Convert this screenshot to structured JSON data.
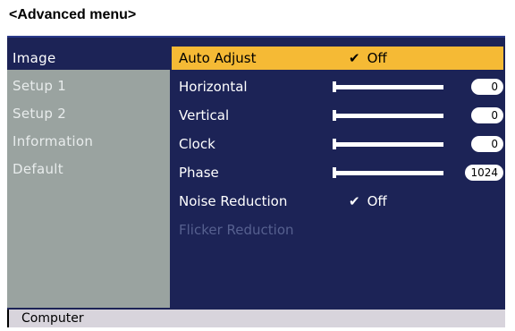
{
  "caption": "<Advanced menu>",
  "sidebar": {
    "items": [
      {
        "label": "Image"
      },
      {
        "label": "Setup 1"
      },
      {
        "label": "Setup 2"
      },
      {
        "label": "Information"
      },
      {
        "label": "Default"
      }
    ]
  },
  "menu": {
    "auto_adjust": {
      "label": "Auto Adjust",
      "mark": "✔",
      "value": "Off"
    },
    "horizontal": {
      "label": "Horizontal",
      "value": "0"
    },
    "vertical": {
      "label": "Vertical",
      "value": "0"
    },
    "clock": {
      "label": "Clock",
      "value": "0"
    },
    "phase": {
      "label": "Phase",
      "value": "1024"
    },
    "noise_reduction": {
      "label": "Noise Reduction",
      "mark": "✔",
      "value": "Off"
    },
    "flicker_reduction": {
      "label": "Flicker Reduction"
    }
  },
  "footer": {
    "source": "Computer"
  }
}
